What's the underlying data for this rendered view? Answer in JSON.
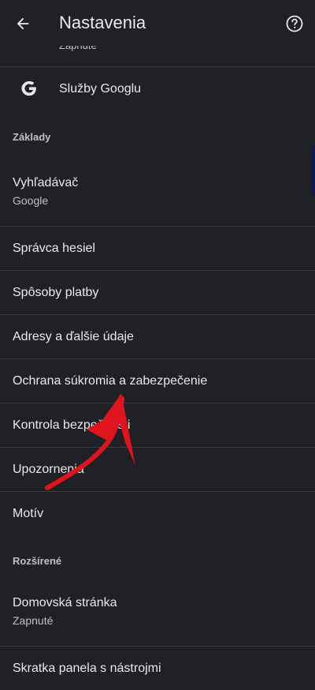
{
  "app_bar": {
    "title": "Nastavenia",
    "back_icon": "arrow-left-icon",
    "help_icon": "help-circle-icon"
  },
  "partial_item": {
    "sub": "Zapnuté"
  },
  "google_services": {
    "label": "Služby Googlu",
    "icon": "google-g-icon"
  },
  "sections": {
    "basics": "Základy",
    "advanced": "Rozšírené"
  },
  "items": {
    "search_engine": {
      "label": "Vyhľadávač",
      "sub": "Google"
    },
    "password_manager": {
      "label": "Správca hesiel"
    },
    "payment_methods": {
      "label": "Spôsoby platby"
    },
    "addresses": {
      "label": "Adresy a ďalšie údaje"
    },
    "privacy": {
      "label": "Ochrana súkromia a zabezpečenie"
    },
    "safety_check": {
      "label": "Kontrola bezpečnosti"
    },
    "notifications": {
      "label": "Upozornenia"
    },
    "theme": {
      "label": "Motív"
    },
    "homepage": {
      "label": "Domovská stránka",
      "sub": "Zapnuté"
    },
    "toolbar_shortcut": {
      "label": "Skratka panela s nástrojmi"
    }
  },
  "colors": {
    "background": "#202124",
    "divider": "#3c4043",
    "annotation_arrow": "#e0141e"
  }
}
